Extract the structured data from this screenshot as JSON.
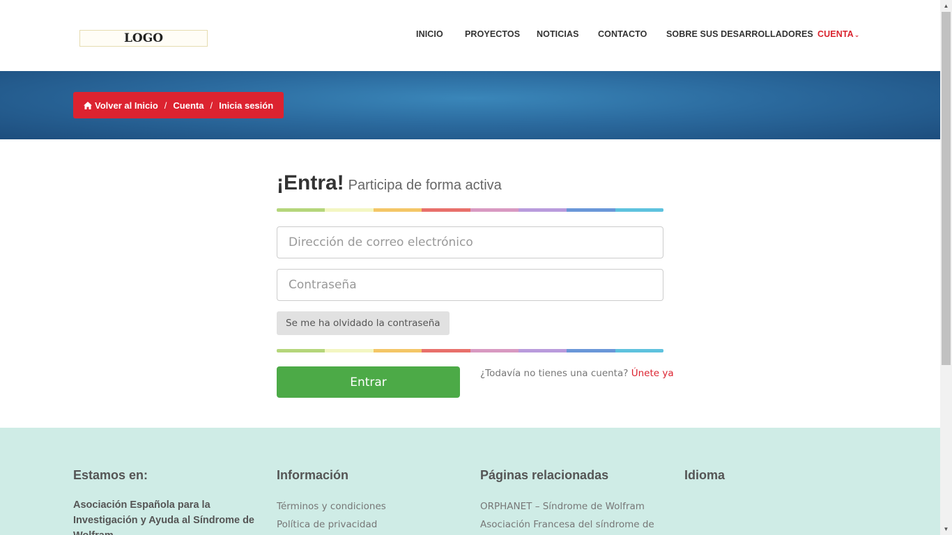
{
  "header": {
    "logo": "LOGO",
    "nav": [
      {
        "label": "INICIO"
      },
      {
        "label": "PROYECTOS"
      },
      {
        "label": "NOTICIAS"
      },
      {
        "label": "CONTACTO"
      },
      {
        "label": "SOBRE SUS DESARROLLADORES"
      },
      {
        "label": "CUENTA",
        "active": true
      }
    ]
  },
  "breadcrumb": {
    "home": "Volver al Inicio",
    "items": [
      "Cuenta",
      "Inicia sesión"
    ],
    "separator": "/"
  },
  "login": {
    "title": "¡Entra!",
    "subtitle": "Participa de forma activa",
    "email_placeholder": "Dirección de correo electrónico",
    "password_placeholder": "Contraseña",
    "forgot_label": "Se me ha olvidado la contraseña",
    "submit_label": "Entrar",
    "signup_prompt": "¿Todavía no tienes una cuenta?",
    "signup_link": "Únete ya",
    "stripe_colors": [
      "#b5d67b",
      "#f3f6c2",
      "#f4c667",
      "#e8706b",
      "#d899c1",
      "#b99bdc",
      "#6a97d8",
      "#5ec2de"
    ]
  },
  "footer": {
    "col1": {
      "heading": "Estamos en:",
      "org": "Asociación Española para la Investigación y Ayuda al Síndrome de Wolfram"
    },
    "col2": {
      "heading": "Información",
      "links": [
        "Términos y condiciones",
        "Política de privacidad"
      ]
    },
    "col3": {
      "heading": "Páginas relacionadas",
      "links": [
        "ORPHANET – Síndrome de Wolfram",
        "Asociación Francesa del síndrome de"
      ]
    },
    "col4": {
      "heading": "Idioma"
    }
  },
  "colors": {
    "accent": "#dc2330",
    "submit": "#4caa47",
    "footer_bg": "#cfece6",
    "banner": "#2b6a9e"
  }
}
